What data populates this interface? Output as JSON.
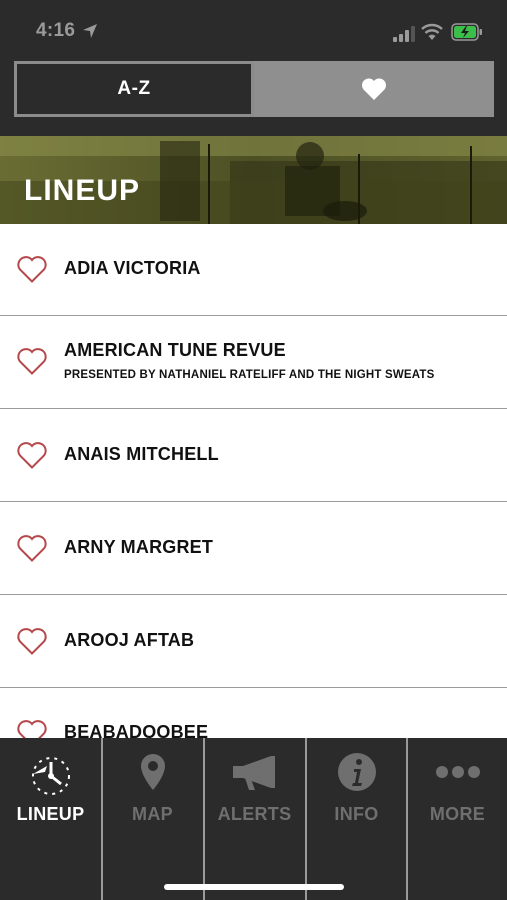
{
  "status_bar": {
    "time": "4:16"
  },
  "segmented_control": {
    "az_label": "A-Z",
    "favorites_icon": "heart-icon"
  },
  "hero": {
    "title": "LINEUP"
  },
  "lineup": {
    "items": [
      {
        "name": "ADIA VICTORIA",
        "subtitle": ""
      },
      {
        "name": "AMERICAN TUNE REVUE",
        "subtitle": "PRESENTED BY NATHANIEL RATELIFF AND THE NIGHT SWEATS"
      },
      {
        "name": "ANAIS MITCHELL",
        "subtitle": ""
      },
      {
        "name": "ARNY MARGRET",
        "subtitle": ""
      },
      {
        "name": "AROOJ AFTAB",
        "subtitle": ""
      },
      {
        "name": "BEABADOOBEE",
        "subtitle": ""
      }
    ]
  },
  "tab_bar": {
    "tabs": [
      {
        "label": "LINEUP",
        "icon": "lineup-icon",
        "active": true
      },
      {
        "label": "MAP",
        "icon": "map-pin-icon",
        "active": false
      },
      {
        "label": "ALERTS",
        "icon": "megaphone-icon",
        "active": false
      },
      {
        "label": "INFO",
        "icon": "info-icon",
        "active": false
      },
      {
        "label": "MORE",
        "icon": "more-icon",
        "active": false
      }
    ]
  },
  "colors": {
    "background_dark": "#2b2b2b",
    "heart_outline": "#b5484a",
    "active_tab": "#ffffff",
    "inactive_tab": "#6f6f6f"
  }
}
